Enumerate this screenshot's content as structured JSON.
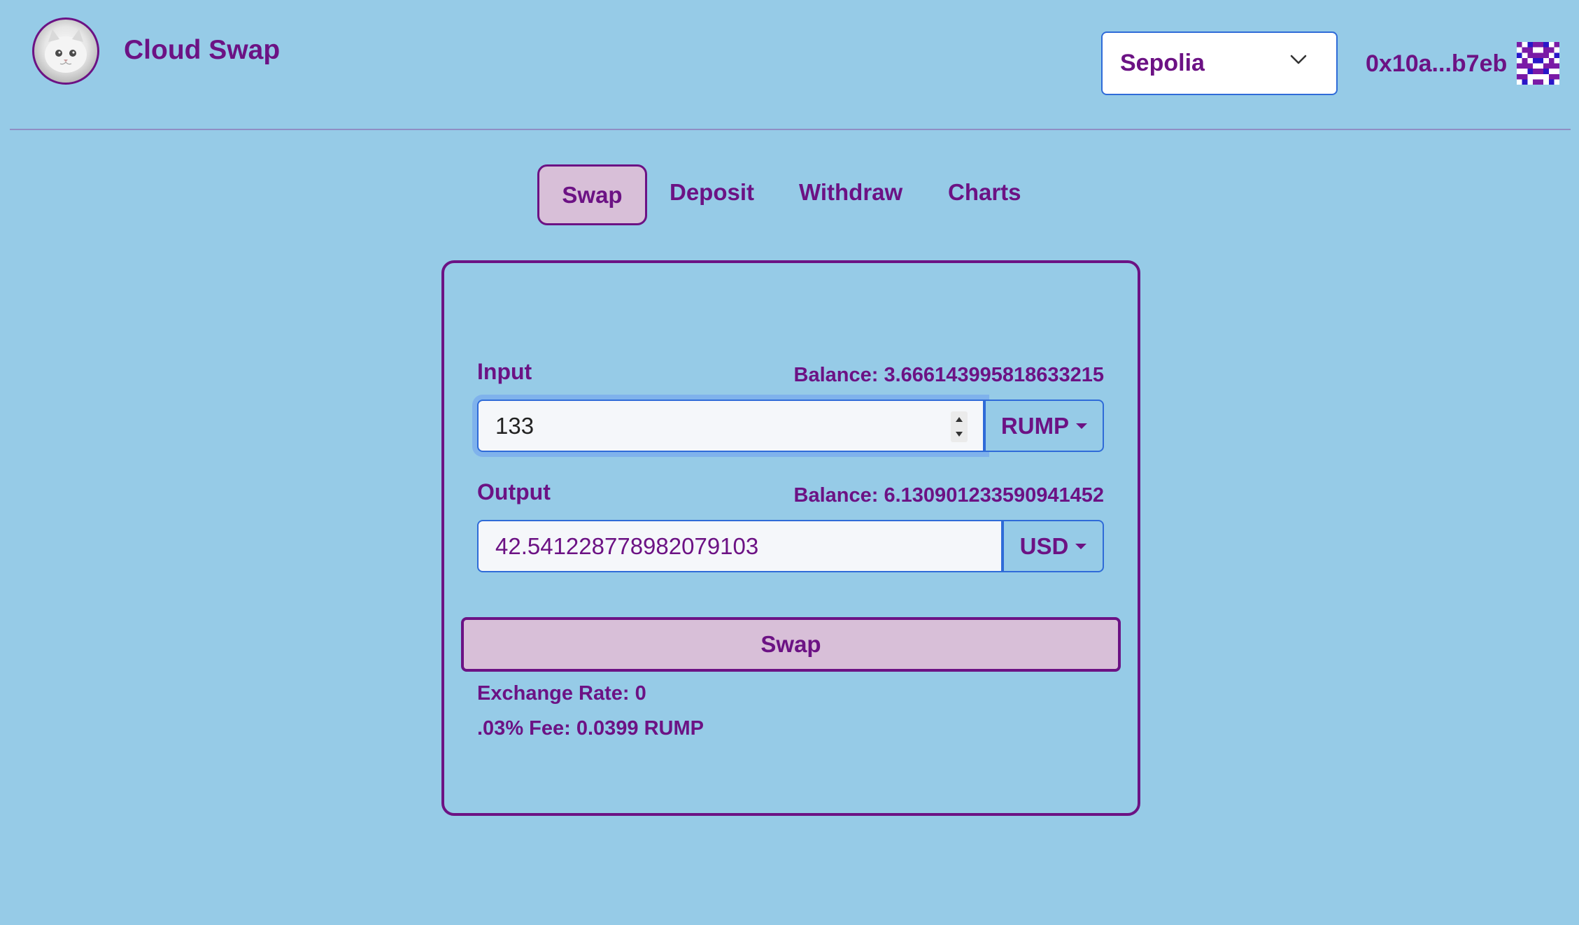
{
  "app": {
    "title": "Cloud Swap",
    "logo_icon": "kitten-avatar-icon"
  },
  "header": {
    "network": "Sepolia",
    "account": "0x10a...b7eb",
    "identicon": "identicon-icon"
  },
  "tabs": [
    {
      "label": "Swap",
      "active": true
    },
    {
      "label": "Deposit",
      "active": false
    },
    {
      "label": "Withdraw",
      "active": false
    },
    {
      "label": "Charts",
      "active": false
    }
  ],
  "swap_form": {
    "input": {
      "label": "Input",
      "balance": "Balance: 3.666143995818633215",
      "value": "133",
      "token": "RUMP"
    },
    "output": {
      "label": "Output",
      "balance": "Balance: 6.130901233590941452",
      "value": "42.541228778982079103",
      "token": "USD"
    },
    "submit_label": "Swap",
    "exchange_rate": "Exchange Rate: 0",
    "fee": ".03% Fee: 0.0399 RUMP"
  },
  "colors": {
    "background": "#96cbe7",
    "accent": "#6c1284",
    "active_fill": "#d8bfd8",
    "input_border": "#2f6bd8"
  }
}
